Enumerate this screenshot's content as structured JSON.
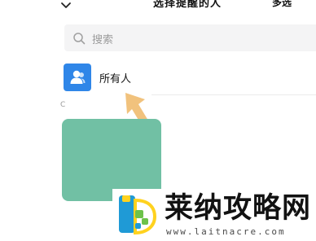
{
  "header": {
    "back_icon": "chevron-down-icon",
    "title": "选择提醒的人",
    "multi_select_label": "多选"
  },
  "search": {
    "icon": "search-icon",
    "placeholder": "搜索"
  },
  "all_members": {
    "icon": "group-people-icon",
    "label": "所有人",
    "avatar_color": "#2f86e8"
  },
  "contacts": {
    "section_letter": "C",
    "first_avatar_color": "#71c0a4"
  },
  "annotation": {
    "icon": "pointer-arrow-icon",
    "color": "#f1c27d"
  },
  "watermark": {
    "logo_icon": "laitnacre-logo",
    "title": "莱纳攻略网",
    "url": "www.laitnacre.com"
  }
}
